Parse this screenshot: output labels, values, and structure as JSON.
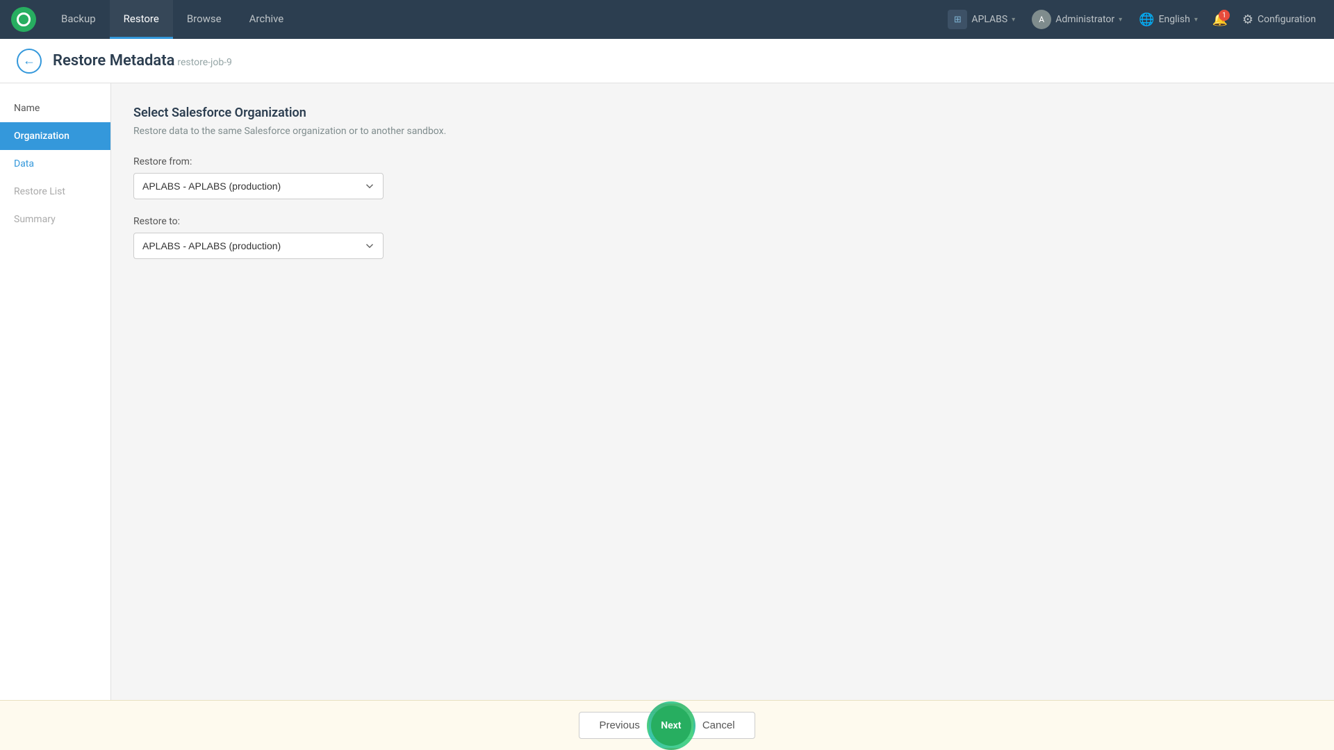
{
  "topbar": {
    "nav_items": [
      {
        "label": "Backup",
        "active": false
      },
      {
        "label": "Restore",
        "active": true
      },
      {
        "label": "Browse",
        "active": false
      },
      {
        "label": "Archive",
        "active": false
      }
    ],
    "org": {
      "name": "APLABS",
      "icon": "🏢"
    },
    "user": {
      "name": "Administrator",
      "initials": "A"
    },
    "language": "English",
    "notification_count": "1",
    "config_label": "Configuration"
  },
  "page": {
    "title": "Restore Metadata",
    "subtitle": "restore-job-9",
    "back_label": "←"
  },
  "sidebar": {
    "items": [
      {
        "label": "Name",
        "state": "default"
      },
      {
        "label": "Organization",
        "state": "active"
      },
      {
        "label": "Data",
        "state": "link"
      },
      {
        "label": "Restore List",
        "state": "muted"
      },
      {
        "label": "Summary",
        "state": "muted"
      }
    ]
  },
  "form": {
    "section_title": "Select Salesforce Organization",
    "section_desc": "Restore data to the same Salesforce organization or to another sandbox.",
    "restore_from_label": "Restore from:",
    "restore_from_value": "APLABS - APLABS (production)",
    "restore_from_options": [
      "APLABS - APLABS (production)"
    ],
    "restore_to_label": "Restore to:",
    "restore_to_value": "APLABS - APLABS (production)",
    "restore_to_options": [
      "APLABS - APLABS (production)"
    ]
  },
  "footer": {
    "previous_label": "Previous",
    "next_label": "Next",
    "cancel_label": "Cancel"
  }
}
